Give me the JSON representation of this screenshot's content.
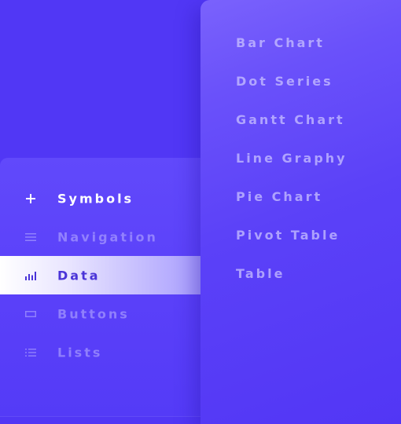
{
  "menu": {
    "items": [
      {
        "label": "Symbols",
        "icon": "plus-icon"
      },
      {
        "label": "Navigation",
        "icon": "menu-lines-icon"
      },
      {
        "label": "Data",
        "icon": "bar-chart-icon"
      },
      {
        "label": "Buttons",
        "icon": "button-rect-icon"
      },
      {
        "label": "Lists",
        "icon": "list-icon"
      }
    ],
    "active": "Data"
  },
  "submenu": {
    "items": [
      {
        "label": "Bar Chart"
      },
      {
        "label": "Dot Series"
      },
      {
        "label": "Gantt Chart"
      },
      {
        "label": "Line Graphy"
      },
      {
        "label": "Pie Chart"
      },
      {
        "label": "Pivot Table"
      },
      {
        "label": "Table"
      }
    ]
  },
  "colors": {
    "background": "#5137f5",
    "active_text": "#4a34d8",
    "active_highlight": "#ffffff"
  }
}
